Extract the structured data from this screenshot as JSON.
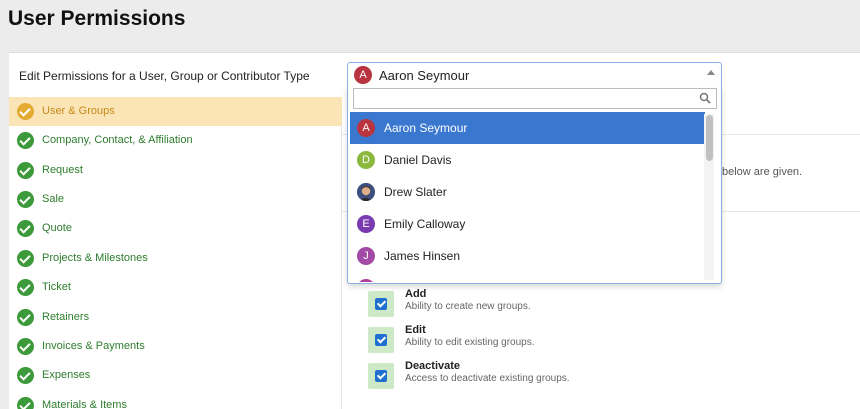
{
  "page": {
    "title": "User Permissions"
  },
  "edit": {
    "label": "Edit Permissions for a User, Group or Contributor Type"
  },
  "selector": {
    "selected_name": "Aaron Seymour",
    "selected_initial": "A",
    "selected_color": "#b8343f"
  },
  "dropdown": {
    "search_value": "",
    "options": [
      {
        "name": "Aaron Seymour",
        "initial": "A",
        "color": "#b8343f",
        "selected": true
      },
      {
        "name": "Daniel Davis",
        "initial": "D",
        "color": "#8bb83d"
      },
      {
        "name": "Drew Slater",
        "initial": "",
        "color": "#6b4a3a",
        "photo": true
      },
      {
        "name": "Emily Calloway",
        "initial": "E",
        "color": "#7a3bb0"
      },
      {
        "name": "James Hinsen",
        "initial": "J",
        "color": "#a24aa6"
      }
    ]
  },
  "sidebar": {
    "items": [
      {
        "label": "User & Groups",
        "active": true
      },
      {
        "label": "Company, Contact, & Affiliation"
      },
      {
        "label": "Request"
      },
      {
        "label": "Sale"
      },
      {
        "label": "Quote"
      },
      {
        "label": "Projects & Milestones"
      },
      {
        "label": "Ticket"
      },
      {
        "label": "Retainers"
      },
      {
        "label": "Invoices & Payments"
      },
      {
        "label": "Expenses"
      },
      {
        "label": "Materials & Items"
      }
    ]
  },
  "peek": {
    "text": "below are given."
  },
  "permissions": [
    {
      "title": "Add",
      "desc": "Ability to create new groups.",
      "checked": true
    },
    {
      "title": "Edit",
      "desc": "Ability to edit existing groups.",
      "checked": true
    },
    {
      "title": "Deactivate",
      "desc": "Access to deactivate existing groups.",
      "checked": true
    }
  ]
}
